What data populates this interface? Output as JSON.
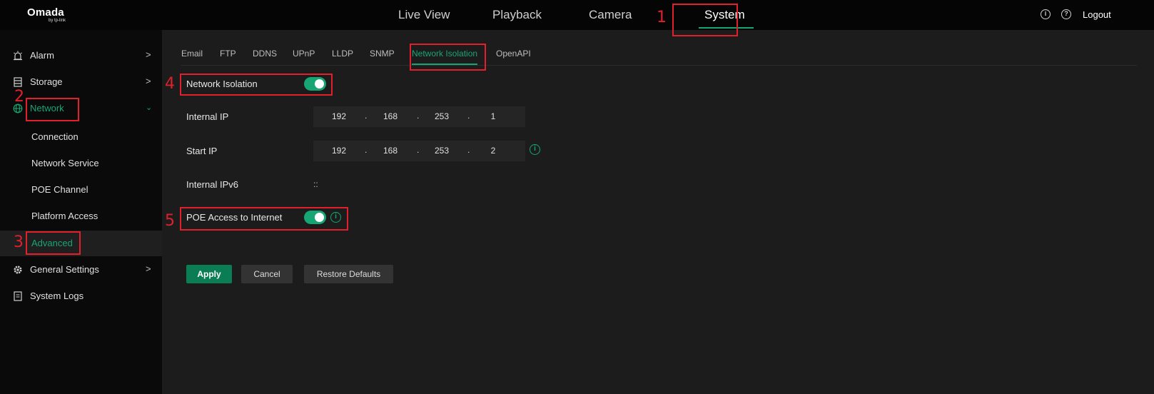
{
  "logo": {
    "main": "Omada",
    "sub": "by tp-link"
  },
  "nav": {
    "live_view": "Live View",
    "playback": "Playback",
    "camera": "Camera",
    "system": "System"
  },
  "header": {
    "info_icon": "info-icon",
    "help_icon": "help-icon",
    "logout": "Logout"
  },
  "sidebar": {
    "alarm": "Alarm",
    "storage": "Storage",
    "network": "Network",
    "connection": "Connection",
    "network_service": "Network Service",
    "poe_channel": "POE Channel",
    "platform_access": "Platform Access",
    "advanced": "Advanced",
    "general_settings": "General Settings",
    "system_logs": "System Logs"
  },
  "tabs": {
    "email": "Email",
    "ftp": "FTP",
    "ddns": "DDNS",
    "upnp": "UPnP",
    "lldp": "LLDP",
    "snmp": "SNMP",
    "network_isolation": "Network Isolation",
    "openapi": "OpenAPI"
  },
  "form": {
    "network_isolation_label": "Network Isolation",
    "network_isolation_enabled": true,
    "internal_ip_label": "Internal IP",
    "internal_ip": [
      "192",
      "168",
      "253",
      "1"
    ],
    "start_ip_label": "Start IP",
    "start_ip": [
      "192",
      "168",
      "253",
      "2"
    ],
    "internal_ipv6_label": "Internal IPv6",
    "internal_ipv6_value": "::",
    "poe_access_label": "POE Access to Internet",
    "poe_access_enabled": true,
    "dot": "."
  },
  "buttons": {
    "apply": "Apply",
    "cancel": "Cancel",
    "restore": "Restore Defaults"
  },
  "annotations": {
    "n1": "1",
    "n2": "2",
    "n3": "3",
    "n4": "4",
    "n5": "5"
  },
  "colors": {
    "accent": "#17a673",
    "annotation": "#e0202b",
    "background": "#1c1c1c"
  }
}
